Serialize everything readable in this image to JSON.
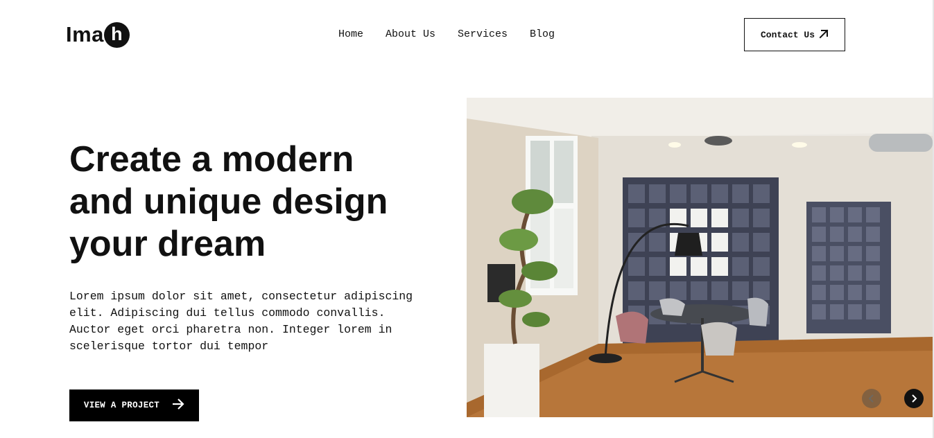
{
  "header": {
    "logo_text": "Ima",
    "logo_letter": "h",
    "nav": [
      {
        "label": "Home"
      },
      {
        "label": "About Us"
      },
      {
        "label": "Services"
      },
      {
        "label": "Blog"
      }
    ],
    "contact_label": "Contact Us",
    "contact_icon": "arrow-up-right-icon"
  },
  "hero": {
    "title_lines": [
      "Create a modern",
      "and unique design",
      "your dream"
    ],
    "description": "Lorem ipsum dolor sit amet, consectetur adipiscing elit. Adipiscing dui tellus commodo convallis. Auctor eget orci pharetra non. Integer lorem in scelerisque tortor dui tempor",
    "cta_label": "VIEW A PROJECT",
    "cta_icon": "arrow-right-icon"
  },
  "slider": {
    "image": "modern-office-interior-photo",
    "prev_icon": "chevron-left-icon",
    "next_icon": "chevron-right-icon"
  },
  "colors": {
    "text": "#111111",
    "button_bg": "#000000",
    "background": "#ffffff"
  }
}
